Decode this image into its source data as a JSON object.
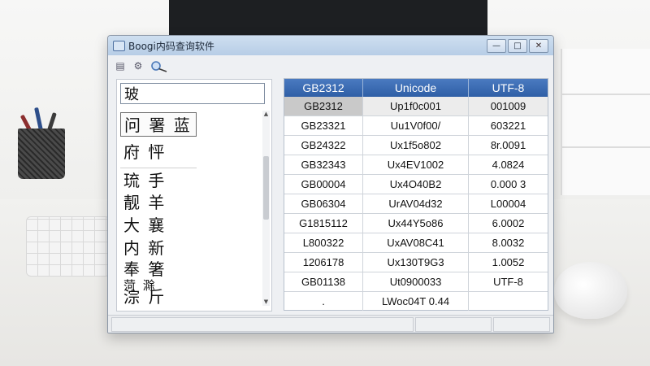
{
  "window": {
    "title": "Boogi内码查询软件",
    "minimize_label": "—",
    "maximize_label": "□",
    "close_label": "✕"
  },
  "toolbar": {
    "icons": [
      "grid-icon",
      "gear-icon",
      "search-icon"
    ]
  },
  "search": {
    "value": "玻"
  },
  "char_list": [
    "问 署 蓝",
    "府  怦",
    "琉  手",
    "靓  羊",
    "大  襄",
    "内  新",
    "奉  箸",
    "菏  滁",
    "淙  斤"
  ],
  "table": {
    "columns": [
      "GB2312",
      "Unicode",
      "UTF-8"
    ],
    "rows": [
      [
        "GB2312",
        "Up1f0c001",
        "001009"
      ],
      [
        "GB23321",
        "Uu1V0f00/",
        "603221"
      ],
      [
        "GB24322",
        "Ux1f5o802",
        "8r.0091"
      ],
      [
        "GB32343",
        "Ux4EV1002",
        "4.0824"
      ],
      [
        "GB00004",
        "Ux4O40B2",
        "0.000 3"
      ],
      [
        "GB06304",
        "UrAV04d32",
        "L00004"
      ],
      [
        "G1815112",
        "Ux44Y5o86",
        "6.0002"
      ],
      [
        "L800322",
        "UxAV08C41",
        "8.0032"
      ],
      [
        "1206178",
        "Ux130T9G3",
        "1.0052"
      ],
      [
        "GB01138",
        "Ut0900033",
        "UTF-8"
      ],
      [
        ".",
        "LWoc04T 0.44",
        ""
      ]
    ]
  },
  "colors": {
    "header_blue": "#3a6bb3",
    "selected_cell": "#c9c9c9"
  }
}
